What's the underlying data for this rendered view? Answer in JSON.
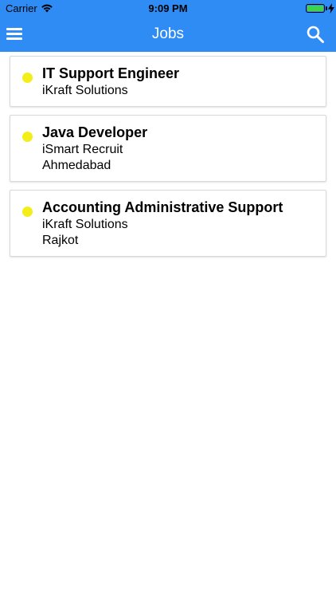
{
  "status_bar": {
    "carrier": "Carrier",
    "time": "9:09 PM",
    "icons": [
      "wifi-icon",
      "battery-icon",
      "charging-icon"
    ]
  },
  "nav": {
    "title": "Jobs",
    "menu_icon": "hamburger-menu-icon",
    "search_icon": "search-icon",
    "background_color": "#2f8cf5"
  },
  "jobs": [
    {
      "title": "IT Support Engineer",
      "company": "iKraft Solutions",
      "location": ""
    },
    {
      "title": "Java Developer",
      "company": "iSmart Recruit",
      "location": "Ahmedabad"
    },
    {
      "title": "Accounting Administrative Support",
      "company": "iKraft Solutions",
      "location": "Rajkot"
    }
  ],
  "colors": {
    "accent": "#2f8cf5",
    "status_dot": "#f3ee1a"
  }
}
